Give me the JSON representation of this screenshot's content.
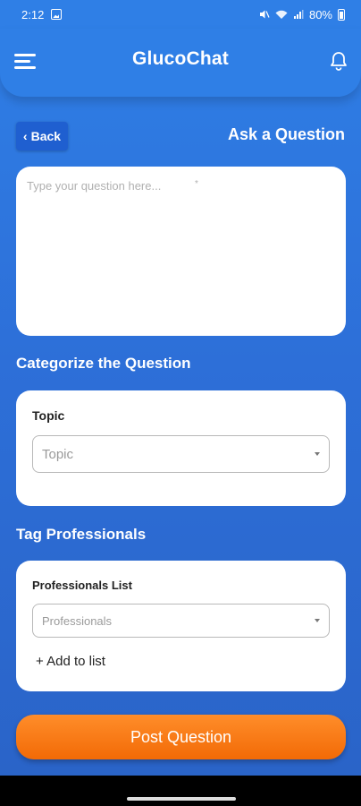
{
  "status_bar": {
    "time": "2:12",
    "battery": "80%"
  },
  "app_bar": {
    "title": "GlucoChat",
    "menu_icon": "hamburger-menu-icon",
    "bell_icon": "bell-icon"
  },
  "toolbar": {
    "back_label": "Back",
    "page_title": "Ask a Question"
  },
  "question": {
    "placeholder": "Type your question here...",
    "required_marker": "*",
    "value": ""
  },
  "categorize": {
    "heading": "Categorize the Question",
    "field_label": "Topic",
    "select_placeholder": "Topic"
  },
  "professionals": {
    "heading": "Tag Professionals",
    "field_label": "Professionals List",
    "select_placeholder": "Professionals",
    "add_label": "+ Add to list"
  },
  "actions": {
    "post_label": "Post Question"
  },
  "colors": {
    "primary": "#2f7fe6",
    "accent_orange": "#f26a06",
    "back_button": "#1f5fd0"
  }
}
